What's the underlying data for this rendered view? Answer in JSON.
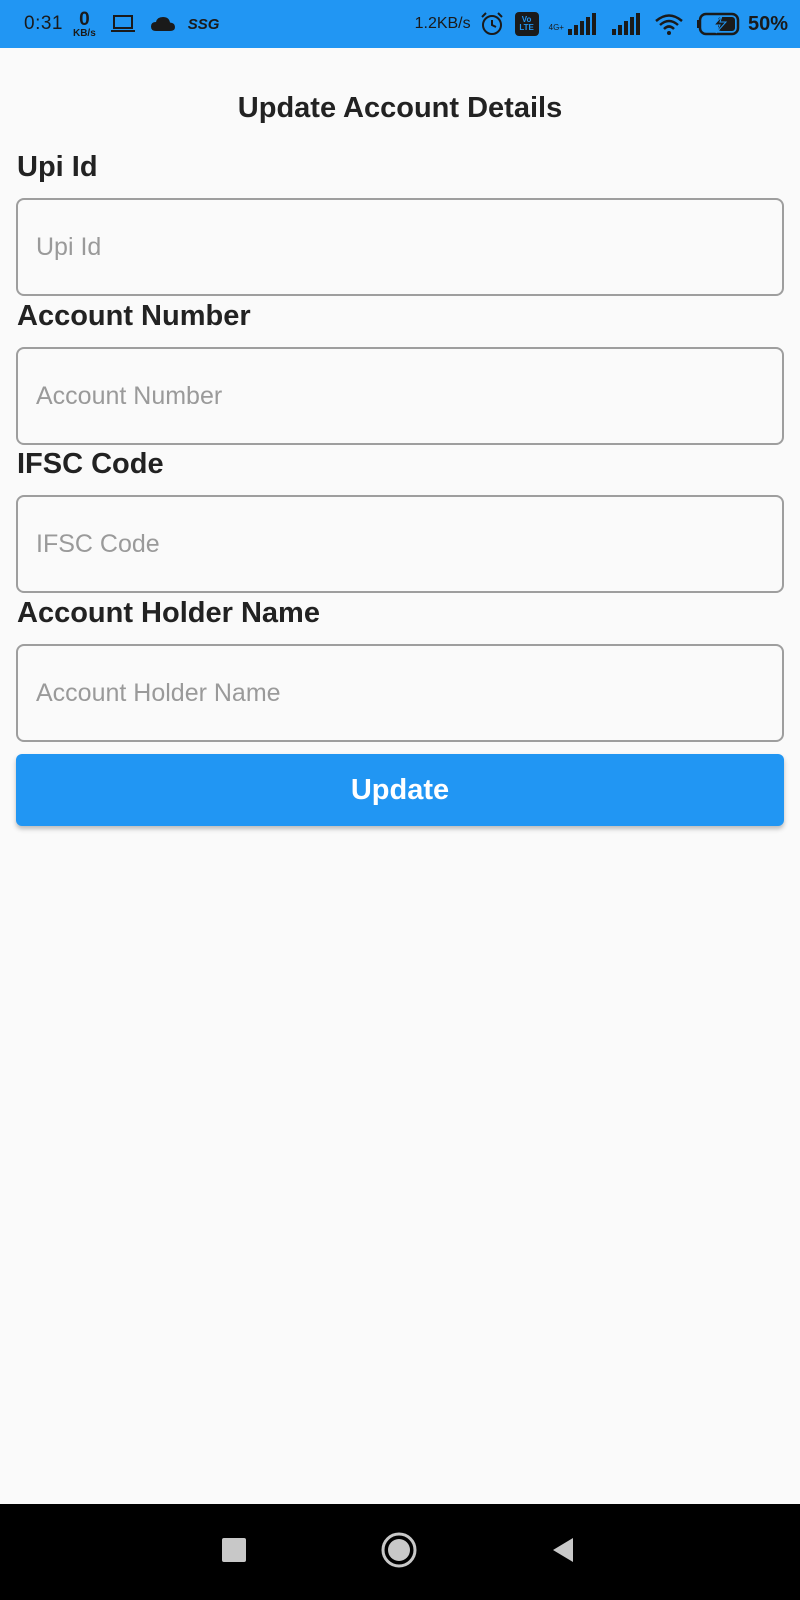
{
  "status_bar": {
    "time": "0:31",
    "data_rate_value": "0",
    "data_rate_unit": "KB/s",
    "carrier_text": "SSG",
    "net_speed": "1.2KB/s",
    "volte_top": "Vo",
    "volte_bottom": "LTE",
    "network_gen": "4G+",
    "battery_percent": "50%",
    "icons": [
      "laptop-icon",
      "cloud-icon",
      "alarm-icon",
      "volte-icon",
      "signal-icon",
      "signal-icon",
      "wifi-icon",
      "battery-charging-icon"
    ]
  },
  "page": {
    "title": "Update Account Details"
  },
  "form": {
    "fields": [
      {
        "label": "Upi Id",
        "placeholder": "Upi Id",
        "value": ""
      },
      {
        "label": "Account Number",
        "placeholder": "Account Number",
        "value": ""
      },
      {
        "label": "IFSC Code",
        "placeholder": "IFSC Code",
        "value": ""
      },
      {
        "label": "Account Holder Name",
        "placeholder": "Account Holder Name",
        "value": ""
      }
    ],
    "submit_label": "Update"
  },
  "nav_bar": {
    "buttons": [
      "recents-icon",
      "home-icon",
      "back-icon"
    ]
  },
  "colors": {
    "primary": "#2196f3",
    "background": "#fafafa",
    "text": "#222222",
    "placeholder": "#9a9a9a",
    "border": "#9e9e9e",
    "nav_background": "#000000"
  }
}
